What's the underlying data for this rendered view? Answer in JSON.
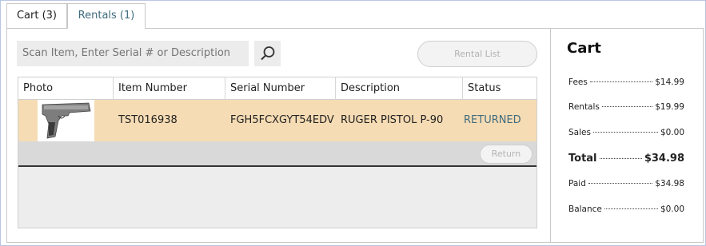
{
  "tabs": [
    {
      "label": "Cart (3)"
    },
    {
      "label": "Rentals (1)"
    }
  ],
  "search": {
    "placeholder": "Scan Item, Enter Serial # or Description"
  },
  "toolbar": {
    "rental_list_label": "Rental List"
  },
  "table": {
    "columns": [
      "Photo",
      "Item Number",
      "Serial Number",
      "Description",
      "Status"
    ],
    "rows": [
      {
        "item_number": "TST016938",
        "serial_number": "FGH5FCXGYT54EDV",
        "description": "RUGER PISTOL P-90",
        "status": "RETURNED"
      }
    ],
    "return_label": "Return"
  },
  "cart": {
    "title": "Cart",
    "fees": {
      "label": "Fees",
      "value": "$14.99"
    },
    "rentals": {
      "label": "Rentals",
      "value": "$19.99"
    },
    "sales": {
      "label": "Sales",
      "value": "$0.00"
    },
    "total": {
      "label": "Total",
      "value": "$34.98"
    },
    "paid": {
      "label": "Paid",
      "value": "$34.98"
    },
    "balance": {
      "label": "Balance",
      "value": "$0.00"
    }
  },
  "colors": {
    "accent": "#3f6b7e",
    "row_highlight": "#f6dcb4"
  }
}
